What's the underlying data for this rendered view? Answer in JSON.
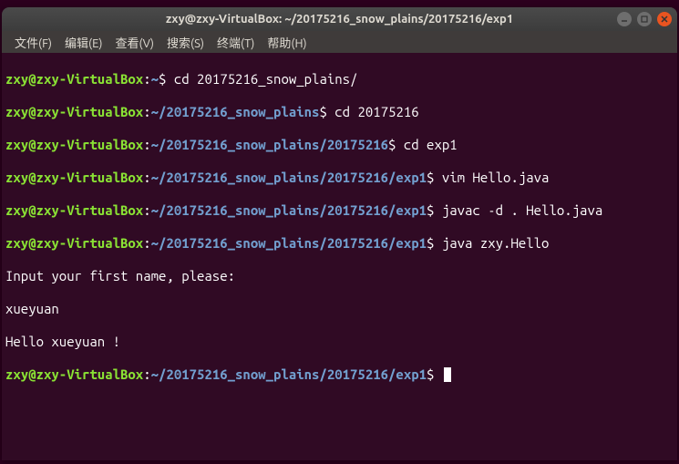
{
  "titlebar": {
    "title": "zxy@zxy-VirtualBox: ~/20175216_snow_plains/20175216/exp1"
  },
  "menubar": {
    "file": "文件(F)",
    "edit": "编辑(E)",
    "view": "查看(V)",
    "search": "搜索(S)",
    "terminal": "终端(T)",
    "help": "帮助(H)"
  },
  "prompt": {
    "user": "zxy",
    "at": "@",
    "host": "zxy-VirtualBox",
    "colon": ":",
    "dollar": "$"
  },
  "lines": {
    "l1": {
      "path": "~",
      "cmd": "cd 20175216_snow_plains/"
    },
    "l2": {
      "path": "~/20175216_snow_plains",
      "cmd": "cd 20175216"
    },
    "l3": {
      "path": "~/20175216_snow_plains/20175216",
      "cmd": "cd exp1"
    },
    "l4": {
      "path": "~/20175216_snow_plains/20175216/exp1",
      "cmd": "vim Hello.java"
    },
    "l5": {
      "path": "~/20175216_snow_plains/20175216/exp1",
      "cmd": "javac -d . Hello.java"
    },
    "l6": {
      "path": "~/20175216_snow_plains/20175216/exp1",
      "cmd": "java zxy.Hello"
    },
    "out1": "Input your first name, please:",
    "out2": "xueyuan",
    "out3": "Hello xueyuan !",
    "l7": {
      "path": "~/20175216_snow_plains/20175216/exp1",
      "cmd": ""
    }
  }
}
